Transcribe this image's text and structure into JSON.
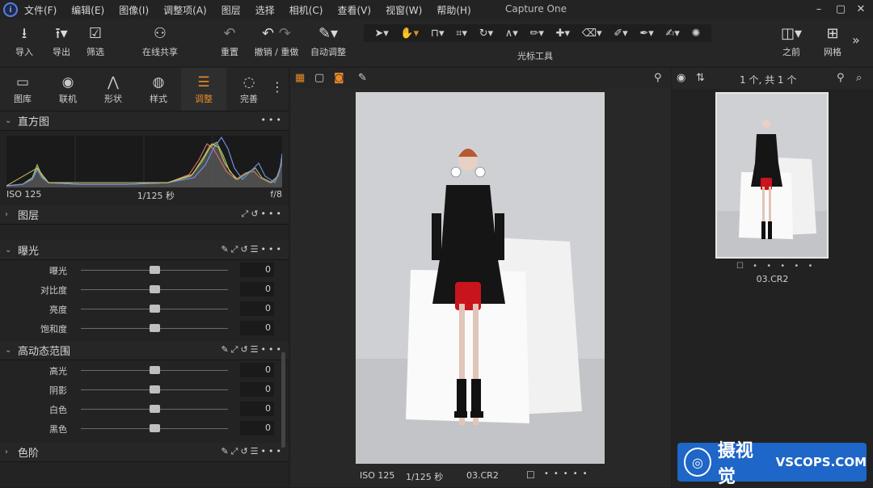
{
  "menubar": {
    "items": [
      "文件(F)",
      "编辑(E)",
      "图像(I)",
      "调整项(A)",
      "图层",
      "选择",
      "相机(C)",
      "查看(V)",
      "视窗(W)",
      "帮助(H)"
    ],
    "title": "Capture One",
    "window": [
      "–",
      "▢",
      "✕"
    ]
  },
  "toolbar": {
    "import": {
      "icon": "download-icon",
      "label": "导入"
    },
    "export": {
      "icon": "upload-icon",
      "label": "导出"
    },
    "filter": {
      "icon": "filter-icon",
      "label": "筛选"
    },
    "share": {
      "icon": "users-icon",
      "label": "在线共享"
    },
    "reset": {
      "icon": "reset-icon",
      "label": "重置"
    },
    "undo_redo": {
      "label": "撤销 / 重做"
    },
    "auto": {
      "icon": "magic-wand-icon",
      "label": "自动调整"
    },
    "cursor_tools_label": "光标工具",
    "before": {
      "icon": "split-view-icon",
      "label": "之前"
    },
    "grid": {
      "icon": "grid-icon",
      "label": "网格"
    }
  },
  "tabs": [
    {
      "label": "图库",
      "icon": "folder-icon"
    },
    {
      "label": "联机",
      "icon": "camera-icon"
    },
    {
      "label": "形状",
      "icon": "compass-icon"
    },
    {
      "label": "样式",
      "icon": "palette-icon"
    },
    {
      "label": "调整",
      "icon": "sliders-icon",
      "active": true
    },
    {
      "label": "完善",
      "icon": "circle-dashed-icon"
    }
  ],
  "histogram": {
    "title": "直方图",
    "iso": "ISO 125",
    "shutter": "1/125 秒",
    "aperture": "f/8"
  },
  "layers": {
    "title": "图层"
  },
  "exposure": {
    "title": "曝光",
    "rows": [
      {
        "label": "曝光",
        "value": "0",
        "level": 0.5
      },
      {
        "label": "对比度",
        "value": "0",
        "level": 0.5
      },
      {
        "label": "亮度",
        "value": "0",
        "level": 0.5
      },
      {
        "label": "饱和度",
        "value": "0",
        "level": 0.5
      }
    ]
  },
  "hdr": {
    "title": "高动态范围",
    "rows": [
      {
        "label": "高光",
        "value": "0",
        "level": 0.5
      },
      {
        "label": "阴影",
        "value": "0",
        "level": 0.5
      },
      {
        "label": "白色",
        "value": "0",
        "level": 0.5
      },
      {
        "label": "黑色",
        "value": "0",
        "level": 0.5
      }
    ]
  },
  "levels": {
    "title": "色阶"
  },
  "viewer": {
    "iso": "ISO 125",
    "shutter": "1/125 秒",
    "file": "03.CR2"
  },
  "browser": {
    "count": "1 个, 共 1 个",
    "file": "03.CR2"
  },
  "watermark": {
    "text": "摄视觉",
    "sub": "VSCOPS.COM"
  }
}
